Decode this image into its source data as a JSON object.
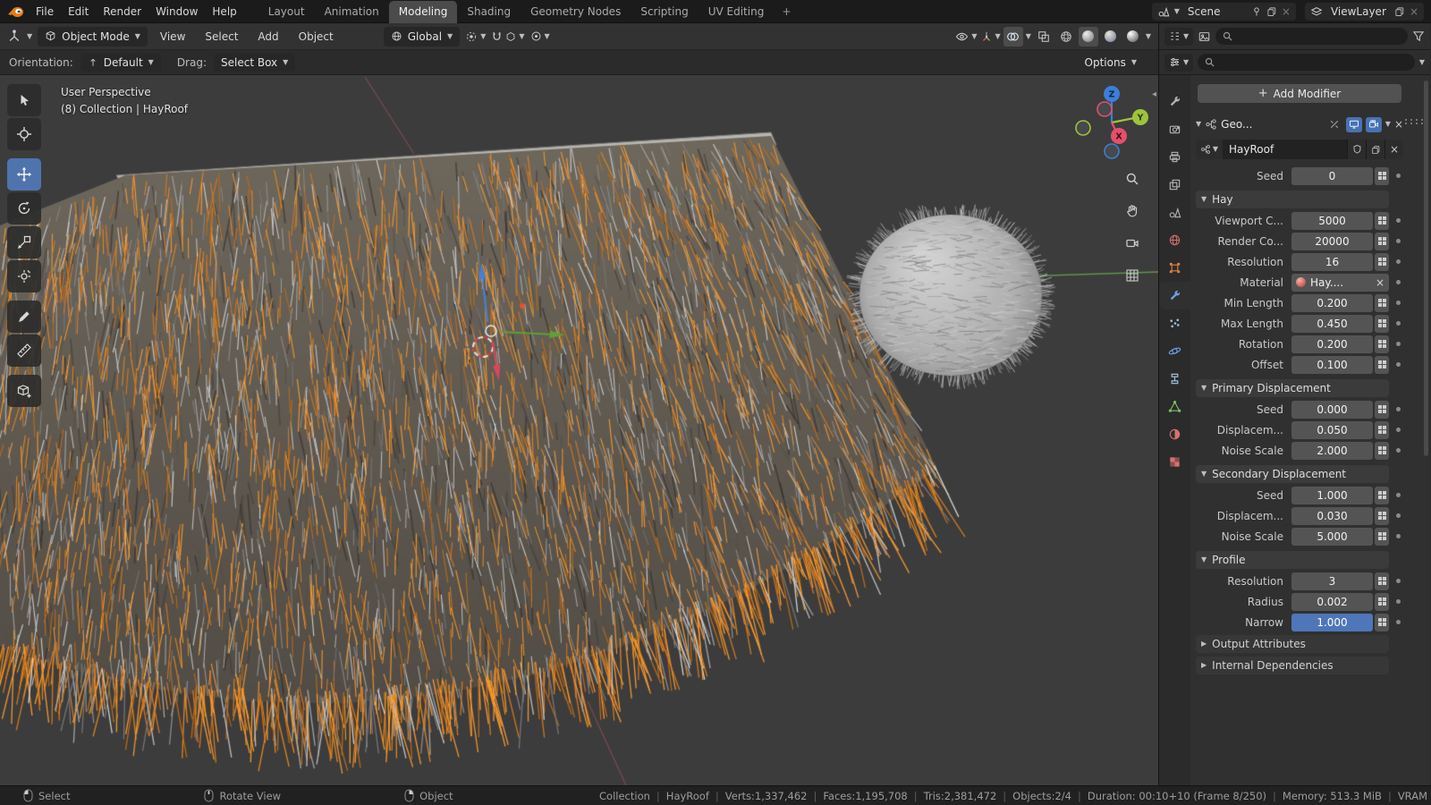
{
  "topbar": {
    "menus": [
      "File",
      "Edit",
      "Render",
      "Window",
      "Help"
    ],
    "workspaces": [
      "Layout",
      "Animation",
      "Modeling",
      "Shading",
      "Geometry Nodes",
      "Scripting",
      "UV Editing"
    ],
    "active_workspace": "Modeling",
    "add_label": "+",
    "scene_label": "Scene",
    "viewlayer_label": "ViewLayer"
  },
  "viewport_header": {
    "mode": "Object Mode",
    "menus": [
      "View",
      "Select",
      "Add",
      "Object"
    ],
    "orientation": "Global"
  },
  "tool_settings": {
    "orientation_label": "Orientation:",
    "orientation_value": "Default",
    "drag_label": "Drag:",
    "drag_value": "Select Box",
    "options": "Options"
  },
  "viewport": {
    "overlay_line1": "User Perspective",
    "overlay_line2": "(8) Collection | HayRoof",
    "axes": {
      "x": "X",
      "y": "Y",
      "z": "Z"
    }
  },
  "properties": {
    "add_modifier": "Add Modifier",
    "modifier_name": "Geo...",
    "node_group": "HayRoof",
    "accent_color": "#4772b3",
    "items": [
      {
        "type": "field",
        "label": "Seed",
        "value": "0"
      },
      {
        "type": "panel",
        "label": "Hay"
      },
      {
        "type": "field",
        "label": "Viewport C...",
        "value": "5000"
      },
      {
        "type": "field",
        "label": "Render Co...",
        "value": "20000"
      },
      {
        "type": "field",
        "label": "Resolution",
        "value": "16"
      },
      {
        "type": "material",
        "label": "Material",
        "value": "Hay...."
      },
      {
        "type": "field",
        "label": "Min Length",
        "value": "0.200"
      },
      {
        "type": "field",
        "label": "Max Length",
        "value": "0.450"
      },
      {
        "type": "field",
        "label": "Rotation",
        "value": "0.200"
      },
      {
        "type": "field",
        "label": "Offset",
        "value": "0.100"
      },
      {
        "type": "panel",
        "label": "Primary Displacement"
      },
      {
        "type": "field",
        "label": "Seed",
        "value": "0.000"
      },
      {
        "type": "field",
        "label": "Displacem...",
        "value": "0.050"
      },
      {
        "type": "field",
        "label": "Noise Scale",
        "value": "2.000"
      },
      {
        "type": "panel",
        "label": "Secondary Displacement"
      },
      {
        "type": "field",
        "label": "Seed",
        "value": "1.000"
      },
      {
        "type": "field",
        "label": "Displacem...",
        "value": "0.030"
      },
      {
        "type": "field",
        "label": "Noise Scale",
        "value": "5.000"
      },
      {
        "type": "panel",
        "label": "Profile"
      },
      {
        "type": "field",
        "label": "Resolution",
        "value": "3"
      },
      {
        "type": "field",
        "label": "Radius",
        "value": "0.002"
      },
      {
        "type": "field",
        "label": "Narrow",
        "value": "1.000",
        "highlight": true
      },
      {
        "type": "collapsed",
        "label": "Output Attributes"
      },
      {
        "type": "collapsed",
        "label": "Internal Dependencies"
      }
    ]
  },
  "statusbar": {
    "hints": [
      {
        "icon": "mouse-left",
        "label": "Select"
      },
      {
        "icon": "mouse-middle",
        "label": "Rotate View"
      },
      {
        "icon": "mouse-right",
        "label": "Object"
      }
    ],
    "stats": [
      "Collection",
      "HayRoof",
      "Verts:1,337,462",
      "Faces:1,195,708",
      "Tris:2,381,472",
      "Objects:2/4",
      "Duration: 00:10+10 (Frame 8/250)",
      "Memory: 513.3 MiB",
      "VRAM"
    ]
  }
}
